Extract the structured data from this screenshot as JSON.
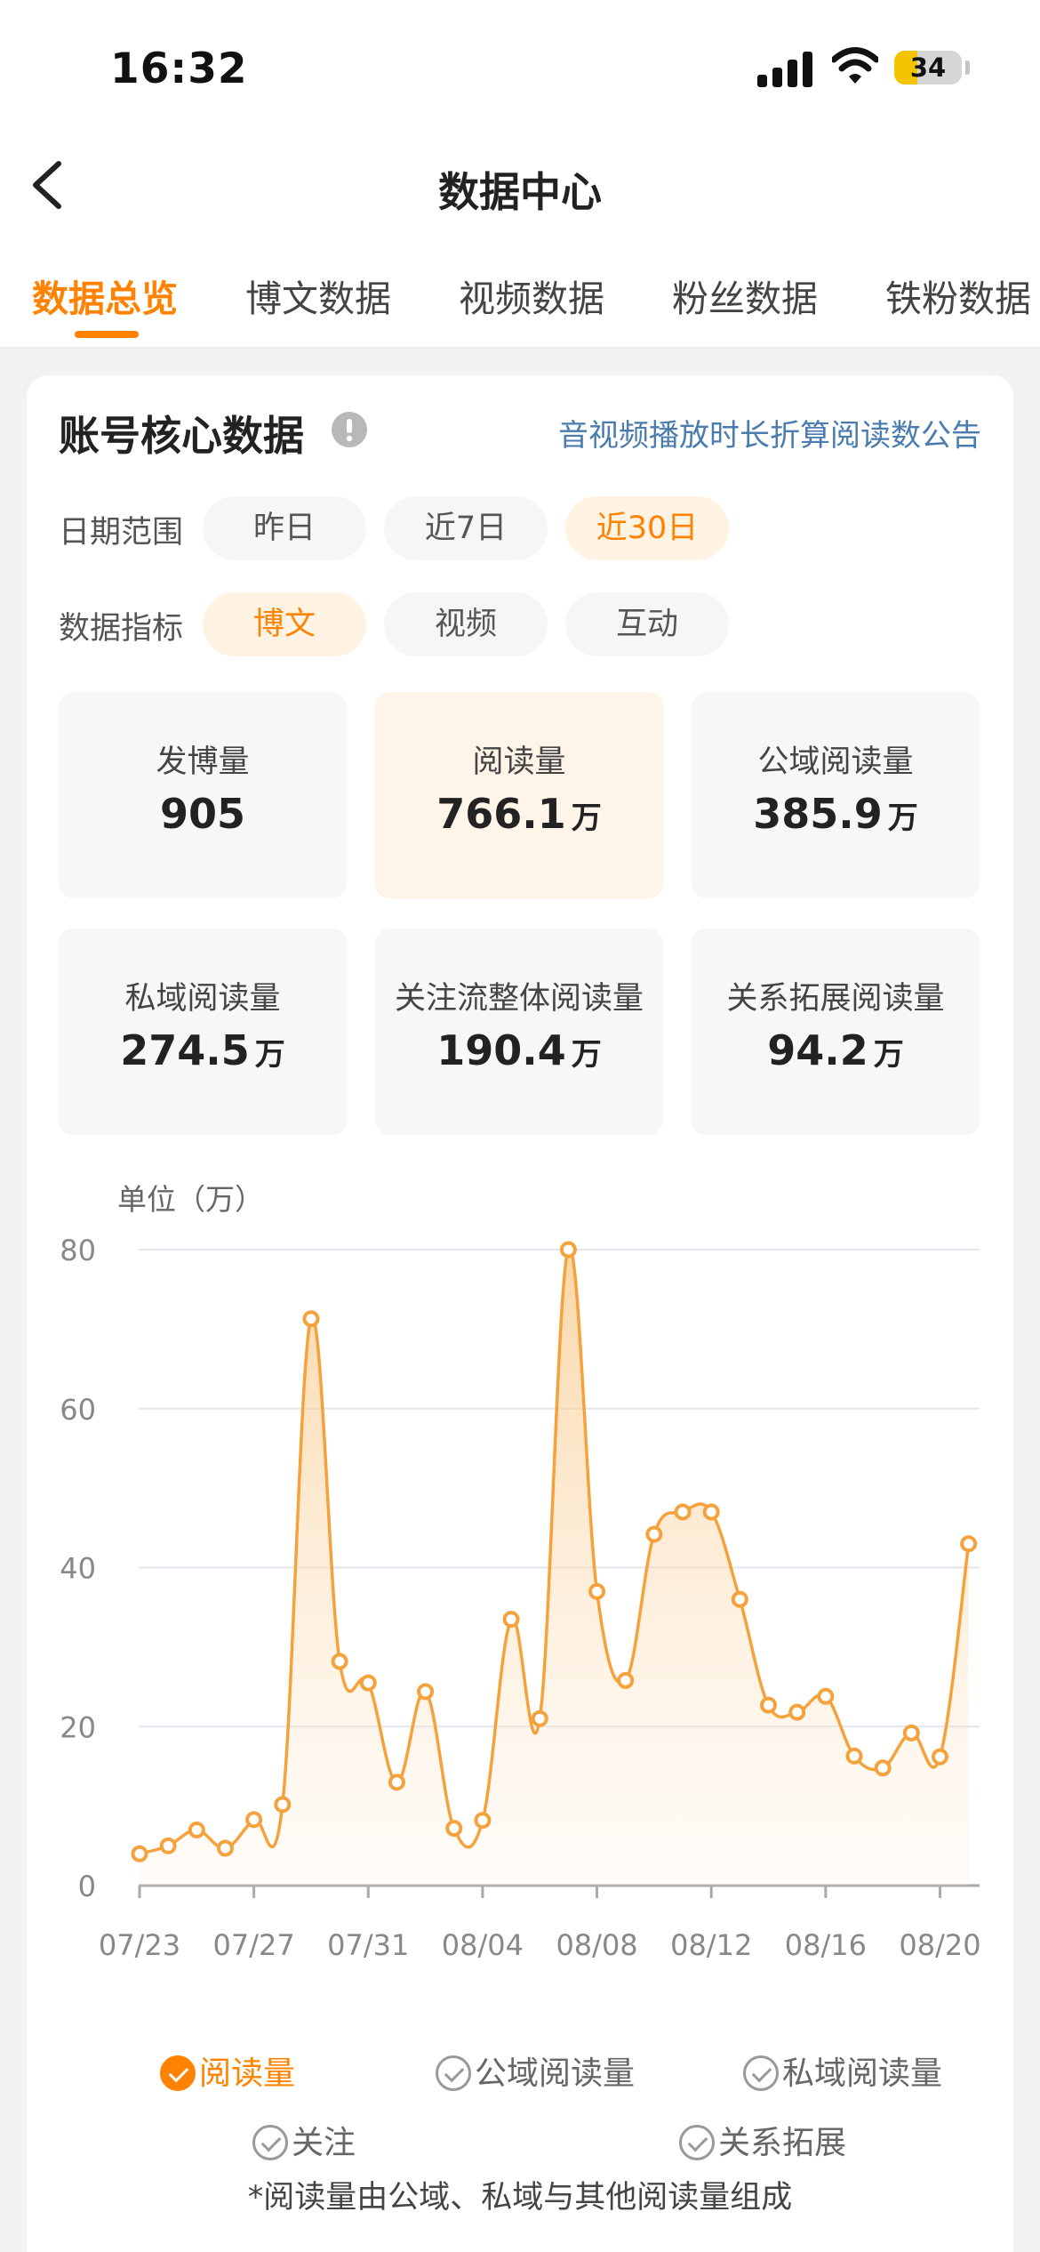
{
  "status_bar": {
    "time": "16:32",
    "battery": "34"
  },
  "nav": {
    "title": "数据中心"
  },
  "tabs": [
    {
      "label": "数据总览",
      "active": true
    },
    {
      "label": "博文数据"
    },
    {
      "label": "视频数据"
    },
    {
      "label": "粉丝数据"
    },
    {
      "label": "铁粉数据"
    }
  ],
  "core": {
    "title": "账号核心数据",
    "notice_link": "音视频播放时长折算阅读数公告",
    "date_range": {
      "label": "日期范围",
      "options": [
        "昨日",
        "近7日",
        "近30日"
      ],
      "selected": "近30日"
    },
    "metric_type": {
      "label": "数据指标",
      "options": [
        "博文",
        "视频",
        "互动"
      ],
      "selected": "博文"
    },
    "metrics": [
      {
        "label": "发博量",
        "value": "905",
        "unit": ""
      },
      {
        "label": "阅读量",
        "value": "766.1",
        "unit": "万",
        "active": true
      },
      {
        "label": "公域阅读量",
        "value": "385.9",
        "unit": "万"
      },
      {
        "label": "私域阅读量",
        "value": "274.5",
        "unit": "万"
      },
      {
        "label": "关注流整体阅读量",
        "value": "190.4",
        "unit": "万"
      },
      {
        "label": "关系拓展阅读量",
        "value": "94.2",
        "unit": "万"
      }
    ]
  },
  "chart_data": {
    "type": "area",
    "unit_label": "单位（万）",
    "yticks": [
      "0",
      "20",
      "40",
      "60",
      "80"
    ],
    "ylim": [
      0,
      80
    ],
    "xtick_labels": [
      "07/23",
      "07/27",
      "07/31",
      "08/04",
      "08/08",
      "08/12",
      "08/16",
      "08/20"
    ],
    "grid": true,
    "color": "#f5a23c",
    "series": [
      {
        "name": "阅读量",
        "x": [
          "07/23",
          "07/24",
          "07/25",
          "07/26",
          "07/27",
          "07/28",
          "07/29",
          "07/30",
          "07/31",
          "08/01",
          "08/02",
          "08/03",
          "08/04",
          "08/05",
          "08/06",
          "08/07",
          "08/08",
          "08/09",
          "08/10",
          "08/11",
          "08/12",
          "08/13",
          "08/14",
          "08/15",
          "08/16",
          "08/17",
          "08/18",
          "08/19",
          "08/20",
          "08/21"
        ],
        "values": [
          4,
          5,
          7,
          4.7,
          8.3,
          10.2,
          71.3,
          28.2,
          25.5,
          13,
          24.4,
          7.2,
          8.2,
          33.5,
          21,
          80,
          37,
          25.8,
          44.2,
          47,
          47,
          36,
          22.7,
          21.8,
          23.8,
          16.3,
          14.8,
          19.2,
          16.2,
          43
        ]
      }
    ]
  },
  "legend": [
    {
      "label": "阅读量",
      "active": true
    },
    {
      "label": "公域阅读量"
    },
    {
      "label": "私域阅读量"
    },
    {
      "label": "关注"
    },
    {
      "label": "关系拓展"
    }
  ],
  "footnote": "*阅读量由公域、私域与其他阅读量组成"
}
